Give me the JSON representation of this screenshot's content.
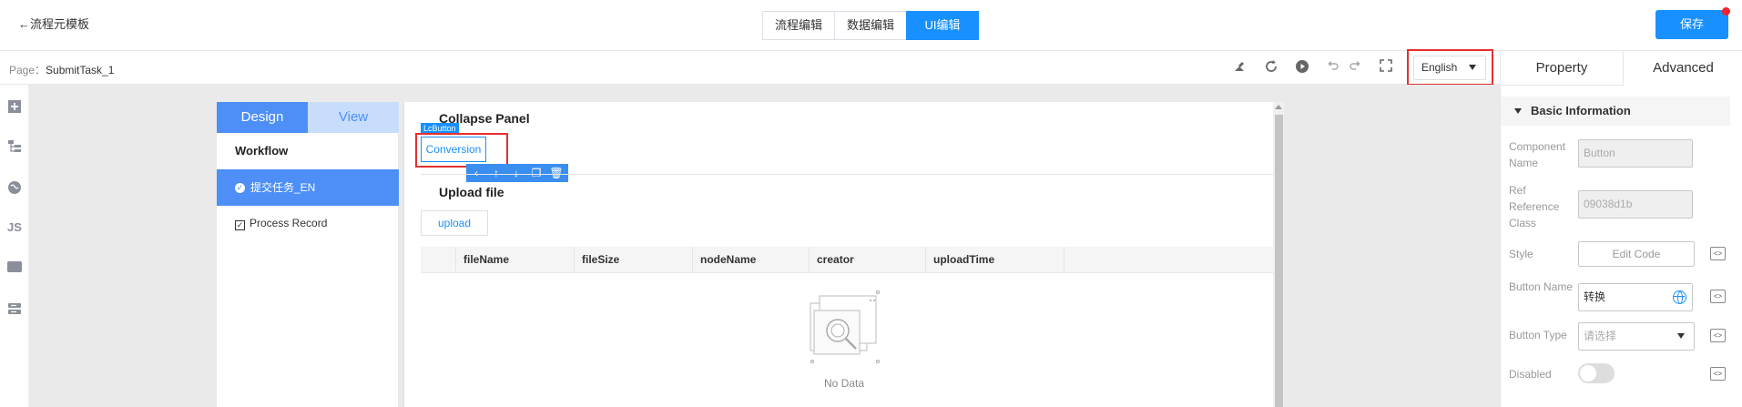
{
  "topbar": {
    "back_label": "←流程元模板",
    "mode_tabs": [
      "流程编辑",
      "数据编辑",
      "UI编辑"
    ],
    "active_mode": "UI编辑",
    "save_label": "保存"
  },
  "pagebar": {
    "page_prefix": "Page：",
    "page_name": "SubmitTask_1",
    "language": "English",
    "tool_icons": [
      "clean-icon",
      "refresh-icon",
      "play-icon",
      "undo-icon",
      "redo-icon",
      "fullscreen-icon"
    ]
  },
  "leftrail": {
    "js_label": "JS",
    "var_label": "var"
  },
  "workflow": {
    "design_tab": "Design",
    "view_tab": "View",
    "title": "Workflow",
    "items": [
      {
        "label": "提交任务_EN",
        "active": true
      },
      {
        "label": "Process Record",
        "active": false
      }
    ]
  },
  "content": {
    "collapse_title": "Collapse Panel",
    "lc_tag": "LcButton",
    "conversion_label": "Conversion",
    "upload_title": "Upload file",
    "upload_label": "upload",
    "columns": [
      "fileName",
      "fileSize",
      "nodeName",
      "creator",
      "uploadTime"
    ],
    "empty_text": "No Data"
  },
  "property": {
    "tab_property": "Property",
    "tab_advanced": "Advanced",
    "section": "Basic Information",
    "component_name_label": "Component Name",
    "component_name_value": "Button",
    "ref_label": "Ref Reference Class",
    "ref_value": "09038d1b",
    "style_label": "Style",
    "style_button": "Edit Code",
    "button_name_label": "Button Name",
    "button_name_value": "转换",
    "button_type_label": "Button Type",
    "button_type_placeholder": "请选择",
    "disabled_label": "Disabled",
    "code_icon_text": "<>"
  },
  "colors": {
    "accent": "#1890ff",
    "design_tab": "#4d8ff7",
    "highlight": "#e53030"
  }
}
